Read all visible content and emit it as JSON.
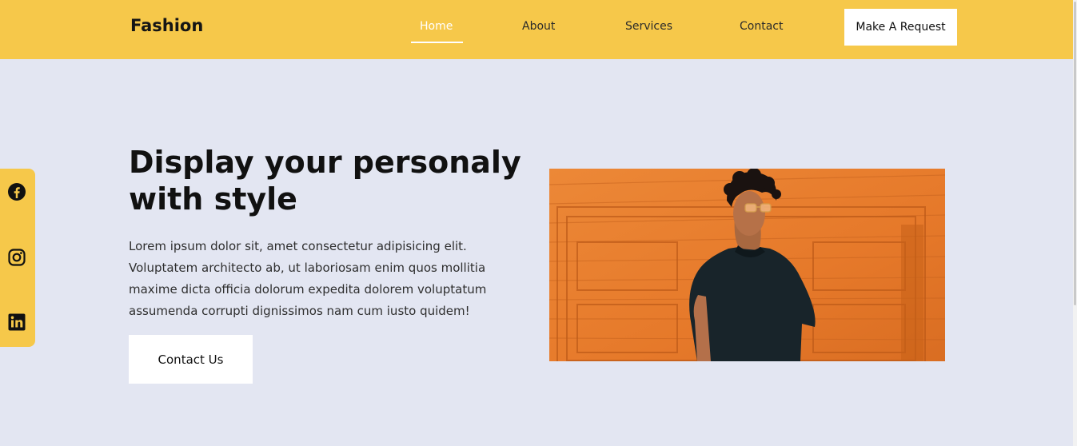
{
  "header": {
    "brand": "Fashion",
    "nav": [
      {
        "label": "Home",
        "active": true
      },
      {
        "label": "About",
        "active": false
      },
      {
        "label": "Services",
        "active": false
      },
      {
        "label": "Contact",
        "active": false
      }
    ],
    "cta_label": "Make A Request"
  },
  "social": {
    "icons": [
      "facebook-icon",
      "instagram-icon",
      "linkedin-icon"
    ]
  },
  "hero": {
    "title_line1": "Display your personaly",
    "title_line2": "with style",
    "body_lines": [
      "Lorem ipsum dolor sit, amet consectetur adipisicing elit.",
      "Voluptatem architecto ab, ut laboriosam enim quos mollitia",
      "maxime dicta officia dolorum expedita dolorem voluptatum",
      "assumenda corrupti dignissimos nam cum iusto quidem!"
    ],
    "button_label": "Contact Us",
    "image_subject": "man-in-black-tshirt-orange-wall"
  },
  "colors": {
    "accent": "#f6c84a",
    "background": "#e3e6f2",
    "button_bg": "#ffffff",
    "text": "#111111",
    "photo_wall": "#e98232"
  }
}
